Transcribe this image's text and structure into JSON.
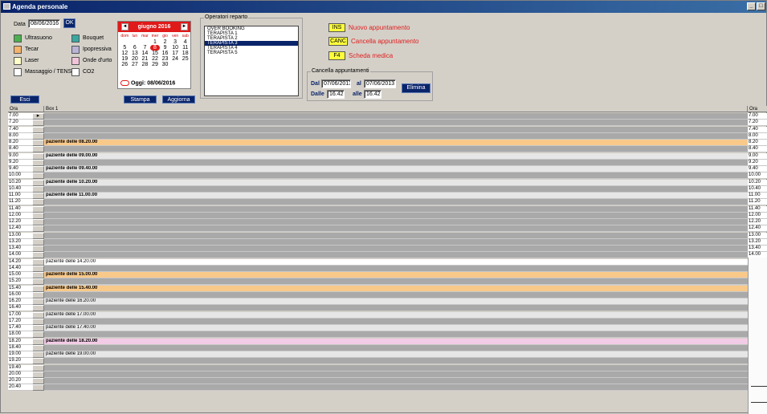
{
  "window": {
    "title": "Agenda personale",
    "controls": [
      "_",
      "□",
      "x"
    ]
  },
  "toolbar": {
    "data_label": "Data",
    "date_value": "08/06/2016",
    "ok_label": "OK",
    "exit_label": "Esci",
    "print_label": "Stampa",
    "refresh_label": "Aggiorna"
  },
  "legend": [
    {
      "label": "Ultrasuono",
      "color": "#4caf50"
    },
    {
      "label": "Bouquet",
      "color": "#3aa6a0"
    },
    {
      "label": "Tecar",
      "color": "#f5b36b"
    },
    {
      "label": "Ipopressiva",
      "color": "#b9b3d6"
    },
    {
      "label": "Laser",
      "color": "#ffffc8"
    },
    {
      "label": "Onde d'urto",
      "color": "#f1c3d9"
    },
    {
      "label": "Massaggio / TENS",
      "color": "#ffffff"
    },
    {
      "label": "CO2",
      "color": "#ffffff"
    }
  ],
  "calendar": {
    "month": "giugno 2016",
    "prev": "◄",
    "next": "►",
    "days": [
      "dom",
      "lun",
      "mar",
      "mer",
      "gio",
      "ven",
      "sab"
    ],
    "weeks": [
      [
        "",
        "",
        "",
        "1",
        "2",
        "3",
        "4"
      ],
      [
        "5",
        "6",
        "7",
        "8",
        "9",
        "10",
        "11"
      ],
      [
        "12",
        "13",
        "14",
        "15",
        "16",
        "17",
        "18"
      ],
      [
        "19",
        "20",
        "21",
        "22",
        "23",
        "24",
        "25"
      ],
      [
        "26",
        "27",
        "28",
        "29",
        "30",
        "",
        ""
      ]
    ],
    "selected": "8",
    "today_label": "Oggi: 08/06/2016"
  },
  "operators": {
    "title": "Operatori reparto",
    "items": [
      "OVER BOOKING",
      "TERAPISTA 1",
      "TERAPISTA 2",
      "TERAPISTA 3",
      "TERAPISTA 4",
      "TERAPISTA 5"
    ],
    "selected_index": 3
  },
  "keys": [
    {
      "key": "INS",
      "text": "Nuovo appuntamento"
    },
    {
      "key": "CANC",
      "text": "Cancella appuntamento"
    },
    {
      "key": "F4",
      "text": "Scheda medica"
    }
  ],
  "cancel_group": {
    "title": "Cancella appuntamenti",
    "dal_label": "Dal",
    "dal_value": "07/06/2013",
    "al_label": "al",
    "al_value": "07/06/2013",
    "dalle_label": "Dalle",
    "dalle_value": "16.42",
    "alle_label": "alle",
    "alle_value": "16.42",
    "delete_label": "Elimina"
  },
  "agenda": {
    "col_time": "Ora",
    "col_box": "Box 1",
    "col_time_right": "Ora",
    "rows": [
      {
        "time": "7.00",
        "text": "",
        "style": "",
        "current": true
      },
      {
        "time": "7.20",
        "text": "",
        "style": ""
      },
      {
        "time": "7.40",
        "text": "",
        "style": ""
      },
      {
        "time": "8.00",
        "text": "",
        "style": ""
      },
      {
        "time": "8.20",
        "text": "paziente delle 08.20.00",
        "style": "orange"
      },
      {
        "time": "8.40",
        "text": "",
        "style": ""
      },
      {
        "time": "9.00",
        "text": "paziente delle 09.00.00",
        "style": "booked-bold"
      },
      {
        "time": "9.20",
        "text": "",
        "style": ""
      },
      {
        "time": "9.40",
        "text": "paziente delle 09.40.00",
        "style": "booked-bold"
      },
      {
        "time": "10.00",
        "text": "",
        "style": ""
      },
      {
        "time": "10.20",
        "text": "paziente delle 10.20.00",
        "style": "booked-bold"
      },
      {
        "time": "10.40",
        "text": "",
        "style": ""
      },
      {
        "time": "11.00",
        "text": "paziente delle 11.00.00",
        "style": "booked-bold"
      },
      {
        "time": "11.20",
        "text": "",
        "style": ""
      },
      {
        "time": "11.40",
        "text": "",
        "style": ""
      },
      {
        "time": "12.00",
        "text": "",
        "style": ""
      },
      {
        "time": "12.20",
        "text": "",
        "style": ""
      },
      {
        "time": "12.40",
        "text": "",
        "style": ""
      },
      {
        "time": "13.00",
        "text": "",
        "style": ""
      },
      {
        "time": "13.20",
        "text": "",
        "style": ""
      },
      {
        "time": "13.40",
        "text": "",
        "style": ""
      },
      {
        "time": "14.00",
        "text": "",
        "style": ""
      },
      {
        "time": "14.20",
        "text": "paziente delle 14.20.00",
        "style": "booked"
      },
      {
        "time": "14.40",
        "text": "",
        "style": ""
      },
      {
        "time": "15.00",
        "text": "paziente delle 15.00.00",
        "style": "orange"
      },
      {
        "time": "15.20",
        "text": "",
        "style": ""
      },
      {
        "time": "15.40",
        "text": "paziente delle 15.40.00",
        "style": "orange"
      },
      {
        "time": "16.00",
        "text": "",
        "style": ""
      },
      {
        "time": "16.20",
        "text": "paziente delle 16.20.00",
        "style": "booked-gray"
      },
      {
        "time": "16.40",
        "text": "",
        "style": ""
      },
      {
        "time": "17.00",
        "text": "paziente delle 17.00.00",
        "style": "booked-gray"
      },
      {
        "time": "17.20",
        "text": "",
        "style": ""
      },
      {
        "time": "17.40",
        "text": "paziente delle 17.40.00",
        "style": "booked-gray"
      },
      {
        "time": "18.00",
        "text": "",
        "style": ""
      },
      {
        "time": "18.20",
        "text": "paziente delle 18.20.00",
        "style": "pink"
      },
      {
        "time": "18.40",
        "text": "",
        "style": ""
      },
      {
        "time": "19.00",
        "text": "paziente delle 19.00.00",
        "style": "booked-gray"
      },
      {
        "time": "19.20",
        "text": "",
        "style": ""
      },
      {
        "time": "19.40",
        "text": "",
        "style": ""
      },
      {
        "time": "20.00",
        "text": "",
        "style": ""
      },
      {
        "time": "20.20",
        "text": "",
        "style": ""
      },
      {
        "time": "20.40",
        "text": "",
        "style": ""
      }
    ]
  }
}
